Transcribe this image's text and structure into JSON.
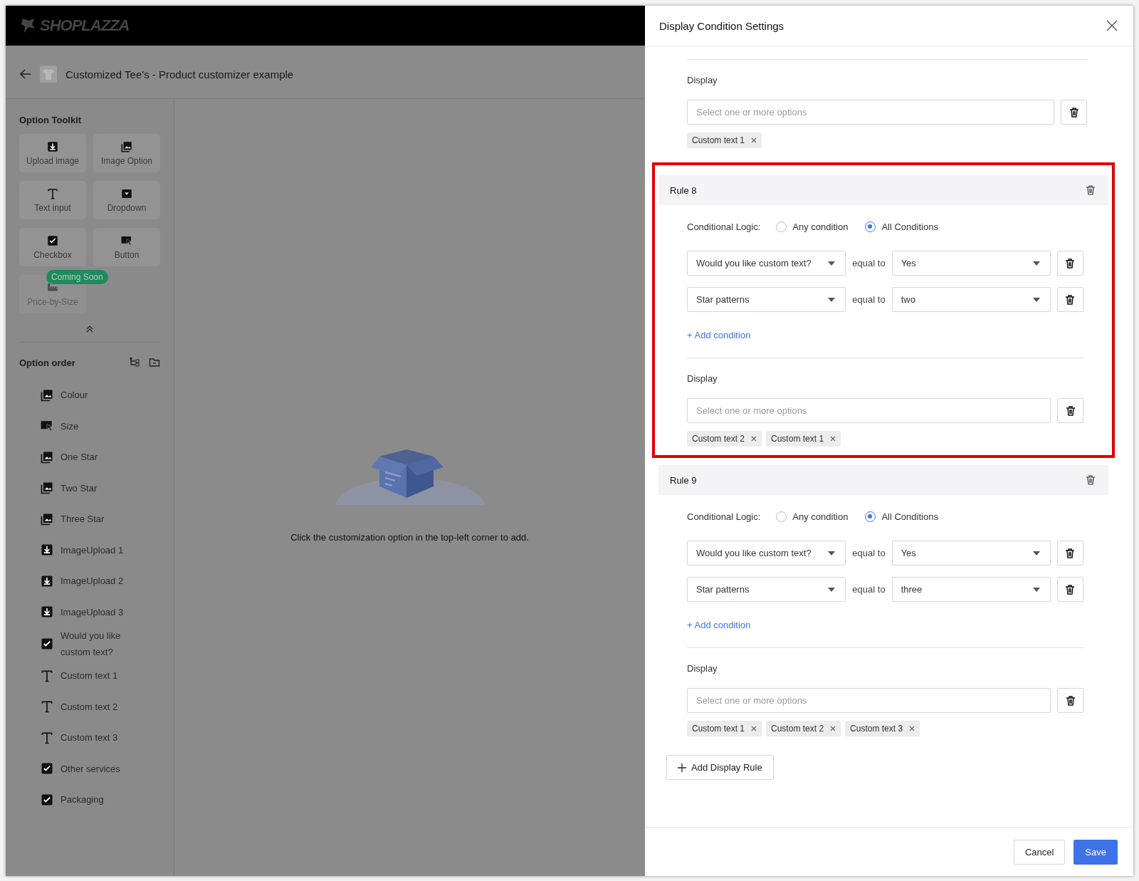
{
  "brand": {
    "logo_text": "SHOPLAZZA"
  },
  "product": {
    "title": "Customized Tee's - Product customizer example"
  },
  "toolkit": {
    "title": "Option Toolkit",
    "tools": [
      {
        "kind": "upload",
        "label": "Upload image",
        "disabled": false
      },
      {
        "kind": "image",
        "label": "Image Option",
        "disabled": false
      },
      {
        "kind": "text",
        "label": "Text input",
        "disabled": false
      },
      {
        "kind": "dropdown",
        "label": "Dropdown",
        "disabled": false
      },
      {
        "kind": "checkbox",
        "label": "Checkbox",
        "disabled": false
      },
      {
        "kind": "button",
        "label": "Button",
        "disabled": false
      },
      {
        "kind": "ruler",
        "label": "Price-by-Size",
        "disabled": true,
        "badge": "Coming Soon"
      }
    ]
  },
  "option_order": {
    "title": "Option order",
    "items": [
      {
        "kind": "image",
        "label": "Colour"
      },
      {
        "kind": "button",
        "label": "Size"
      },
      {
        "kind": "image",
        "label": "One Star"
      },
      {
        "kind": "image",
        "label": "Two Star"
      },
      {
        "kind": "image",
        "label": "Three Star"
      },
      {
        "kind": "upload",
        "label": "ImageUpload 1"
      },
      {
        "kind": "upload",
        "label": "ImageUpload 2"
      },
      {
        "kind": "upload",
        "label": "ImageUpload 3"
      },
      {
        "kind": "checkbox",
        "label": "Would you like custom text?"
      },
      {
        "kind": "text",
        "label": "Custom text 1"
      },
      {
        "kind": "text",
        "label": "Custom text 2"
      },
      {
        "kind": "text",
        "label": "Custom text 3"
      },
      {
        "kind": "checkbox",
        "label": "Other services"
      },
      {
        "kind": "checkbox",
        "label": "Packaging"
      }
    ]
  },
  "canvas": {
    "empty_message": "Click the customization option in the top-left corner to add."
  },
  "drawer": {
    "title": "Display Condition Settings",
    "partial_display": {
      "label": "Display",
      "placeholder": "Select one or more options",
      "tags": [
        "Custom text 1"
      ]
    },
    "rules": [
      {
        "title": "Rule 8",
        "highlighted": true,
        "logic_label": "Conditional Logic:",
        "logic_options": [
          {
            "label": "Any condition",
            "selected": false
          },
          {
            "label": "All Conditions",
            "selected": true
          }
        ],
        "conditions": [
          {
            "field": "Would you like custom text?",
            "operator": "equal to",
            "value": "Yes"
          },
          {
            "field": "Star patterns",
            "operator": "equal to",
            "value": "two"
          }
        ],
        "add_condition": "+ Add condition",
        "display": {
          "label": "Display",
          "placeholder": "Select one or more options",
          "tags": [
            "Custom text 2",
            "Custom text 1"
          ]
        }
      },
      {
        "title": "Rule 9",
        "highlighted": false,
        "logic_label": "Conditional Logic:",
        "logic_options": [
          {
            "label": "Any condition",
            "selected": false
          },
          {
            "label": "All Conditions",
            "selected": true
          }
        ],
        "conditions": [
          {
            "field": "Would you like custom text?",
            "operator": "equal to",
            "value": "Yes"
          },
          {
            "field": "Star patterns",
            "operator": "equal to",
            "value": "three"
          }
        ],
        "add_condition": "+ Add condition",
        "display": {
          "label": "Display",
          "placeholder": "Select one or more options",
          "tags": [
            "Custom text 1",
            "Custom text 2",
            "Custom text 3"
          ]
        }
      }
    ],
    "add_rule": "Add Display Rule",
    "buttons": [
      {
        "kind": "secondary",
        "label": "Cancel"
      },
      {
        "kind": "primary",
        "label": "Save"
      }
    ]
  }
}
